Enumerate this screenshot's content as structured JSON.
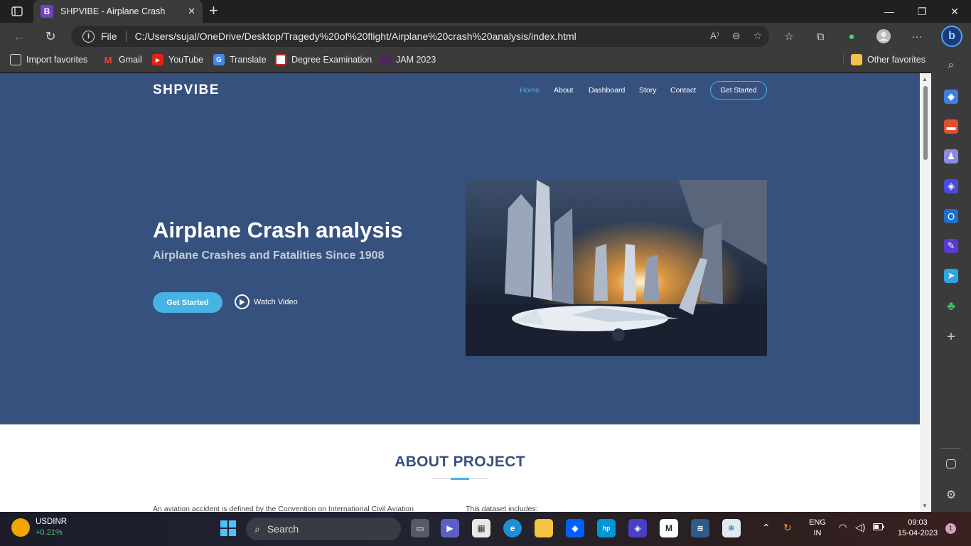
{
  "browser": {
    "tab_title": "SHPVIBE - Airplane Crash",
    "tab_favicon_letter": "B",
    "address_scheme_label": "File",
    "address_url": "C:/Users/sujal/OneDrive/Desktop/Tragedy%20of%20flight/Airplane%20crash%20analysis/index.html",
    "favorites": [
      {
        "label": "Import favorites",
        "icon": "import-icon"
      },
      {
        "label": "Gmail",
        "icon": "gmail-icon"
      },
      {
        "label": "YouTube",
        "icon": "youtube-icon"
      },
      {
        "label": "Translate",
        "icon": "translate-icon"
      },
      {
        "label": "Degree Examination",
        "icon": "exam-icon"
      },
      {
        "label": "JAM 2023",
        "icon": "jam-icon"
      }
    ],
    "other_favorites": "Other favorites"
  },
  "page": {
    "brand": "SHPVIBE",
    "nav": {
      "home": "Home",
      "about": "About",
      "dashboard": "Dashboard",
      "story": "Story",
      "contact": "Contact",
      "cta": "Get Started"
    },
    "hero": {
      "title": "Airplane Crash analysis",
      "subtitle": "Airplane Crashes and Fatalities Since 1908",
      "primary_button": "Get Started",
      "video_link": "Watch Video"
    },
    "about": {
      "title": "ABOUT PROJECT",
      "left_text": "An aviation accident is defined by the Convention on International Civil Aviation",
      "right_text": "This dataset includes:"
    }
  },
  "taskbar": {
    "widget_name": "USDINR",
    "widget_value": "+0.21%",
    "search_label": "Search",
    "lang_line1": "ENG",
    "lang_line2": "IN",
    "time": "09:03",
    "date": "15-04-2023",
    "notification_count": "1"
  },
  "colors": {
    "hero_bg": "#37517e",
    "accent": "#47b2e4"
  }
}
